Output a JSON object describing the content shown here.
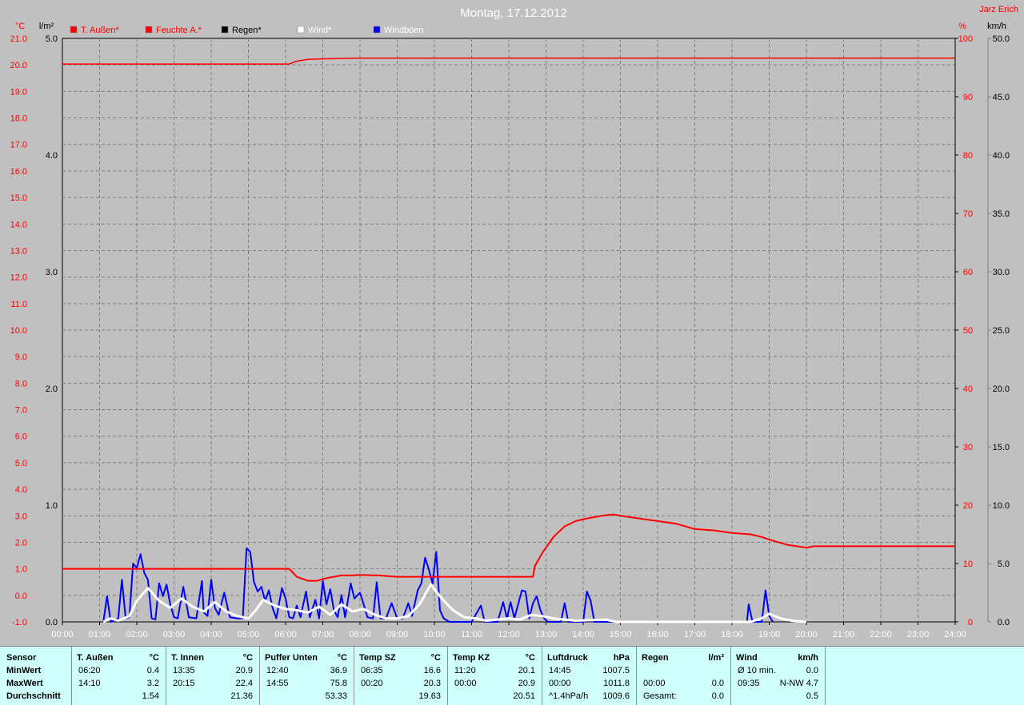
{
  "header": {
    "title": "Montag, 17.12.2012",
    "station": "Jarz Erich"
  },
  "units": {
    "temp": "°C",
    "rain": "l/m²",
    "humidity": "%",
    "wind": "km/h"
  },
  "legend": [
    {
      "label": "T. Außen*",
      "color": "#ff0000",
      "text_color": "#ff0000"
    },
    {
      "label": "Feuchte A.*",
      "color": "#ff0000",
      "text_color": "#ff0000"
    },
    {
      "label": "Regen*",
      "color": "#000000",
      "text_color": "#000000"
    },
    {
      "label": "Wind*",
      "color": "#ffffff",
      "text_color": "#ffffff"
    },
    {
      "label": "Windböen",
      "color": "#0000ff",
      "text_color": "#ffffff"
    }
  ],
  "colors": {
    "background": "#c0c0c0",
    "temp": "#ff0000",
    "humidity": "#ff0000",
    "wind": "#ffffff",
    "gust": "#0000ff",
    "grid": "#808080",
    "stats_bg": "#cffffb"
  },
  "axes": {
    "temp_ticks": [
      "21.0",
      "20.0",
      "19.0",
      "18.0",
      "17.0",
      "16.0",
      "15.0",
      "14.0",
      "13.0",
      "12.0",
      "11.0",
      "10.0",
      "9.0",
      "8.0",
      "7.0",
      "6.0",
      "5.0",
      "4.0",
      "3.0",
      "2.0",
      "1.0",
      "0.0",
      "-1.0"
    ],
    "rain_ticks": [
      "5.0",
      "4.0",
      "3.0",
      "2.0",
      "1.0",
      "0.0"
    ],
    "humidity_ticks": [
      "100",
      "90",
      "80",
      "70",
      "60",
      "50",
      "40",
      "30",
      "20",
      "10",
      "0"
    ],
    "wind_ticks": [
      "50.0",
      "45.0",
      "40.0",
      "35.0",
      "30.0",
      "25.0",
      "20.0",
      "15.0",
      "10.0",
      "5.0",
      "0.0"
    ],
    "time_ticks": [
      "00:00",
      "01:00",
      "02:00",
      "03:00",
      "04:00",
      "05:00",
      "06:00",
      "07:00",
      "08:00",
      "09:00",
      "10:00",
      "11:00",
      "12:00",
      "13:00",
      "14:00",
      "15:00",
      "16:00",
      "17:00",
      "18:00",
      "19:00",
      "20:00",
      "21:00",
      "22:00",
      "23:00",
      "24:00"
    ]
  },
  "chart_data": {
    "type": "line",
    "title": "Montag, 17.12.2012",
    "x_unit": "hours",
    "xlim": [
      0,
      24
    ],
    "ylim_temp": [
      -1,
      21
    ],
    "ylim_rain": [
      0,
      5
    ],
    "ylim_humidity": [
      0,
      100
    ],
    "ylim_wind": [
      0,
      50
    ],
    "grid": true,
    "legend_position": "top-left",
    "series": [
      {
        "name": "T. Außen*",
        "axis": "temp",
        "points": [
          [
            0,
            1.0
          ],
          [
            6.1,
            1.0
          ],
          [
            6.3,
            0.7
          ],
          [
            6.6,
            0.55
          ],
          [
            6.85,
            0.55
          ],
          [
            7.1,
            0.65
          ],
          [
            7.5,
            0.75
          ],
          [
            7.8,
            0.75
          ],
          [
            8.0,
            0.77
          ],
          [
            8.5,
            0.75
          ],
          [
            9.0,
            0.7
          ],
          [
            9.5,
            0.7
          ],
          [
            10.0,
            0.7
          ],
          [
            11.0,
            0.7
          ],
          [
            12.0,
            0.7
          ],
          [
            12.65,
            0.7
          ],
          [
            12.7,
            1.1
          ],
          [
            12.9,
            1.6
          ],
          [
            13.2,
            2.2
          ],
          [
            13.5,
            2.6
          ],
          [
            13.8,
            2.8
          ],
          [
            14.1,
            2.9
          ],
          [
            14.5,
            3.0
          ],
          [
            14.8,
            3.05
          ],
          [
            15.0,
            3.0
          ],
          [
            15.5,
            2.9
          ],
          [
            16.0,
            2.8
          ],
          [
            16.5,
            2.7
          ],
          [
            17.0,
            2.5
          ],
          [
            17.5,
            2.45
          ],
          [
            18.0,
            2.35
          ],
          [
            18.5,
            2.3
          ],
          [
            18.8,
            2.2
          ],
          [
            19.0,
            2.1
          ],
          [
            19.5,
            1.9
          ],
          [
            20.0,
            1.8
          ],
          [
            20.2,
            1.85
          ],
          [
            21.0,
            1.85
          ],
          [
            22.0,
            1.85
          ],
          [
            23.0,
            1.85
          ],
          [
            24.0,
            1.85
          ]
        ]
      },
      {
        "name": "Feuchte A.*",
        "axis": "humidity",
        "points": [
          [
            0,
            95.6
          ],
          [
            6.1,
            95.6
          ],
          [
            6.3,
            96.1
          ],
          [
            6.6,
            96.4
          ],
          [
            7.0,
            96.5
          ],
          [
            8.0,
            96.6
          ],
          [
            12.0,
            96.6
          ],
          [
            16.0,
            96.6
          ],
          [
            20.0,
            96.6
          ],
          [
            24.0,
            96.6
          ]
        ]
      },
      {
        "name": "Wind*",
        "axis": "wind",
        "points": [
          [
            1.1,
            0
          ],
          [
            1.3,
            0.3
          ],
          [
            1.5,
            0.1
          ],
          [
            1.8,
            0.5
          ],
          [
            2.0,
            1.8
          ],
          [
            2.3,
            2.9
          ],
          [
            2.6,
            1.8
          ],
          [
            2.9,
            1.2
          ],
          [
            3.2,
            2.0
          ],
          [
            3.5,
            1.3
          ],
          [
            3.8,
            0.9
          ],
          [
            4.1,
            1.7
          ],
          [
            4.4,
            0.9
          ],
          [
            4.7,
            0.5
          ],
          [
            5.0,
            0.3
          ],
          [
            5.2,
            1.0
          ],
          [
            5.4,
            1.9
          ],
          [
            5.7,
            1.4
          ],
          [
            6.0,
            1.1
          ],
          [
            6.3,
            1.0
          ],
          [
            6.6,
            0.8
          ],
          [
            6.9,
            1.3
          ],
          [
            7.2,
            0.6
          ],
          [
            7.5,
            1.5
          ],
          [
            7.8,
            0.9
          ],
          [
            8.1,
            1.1
          ],
          [
            8.4,
            0.6
          ],
          [
            8.7,
            0.3
          ],
          [
            9.0,
            0.3
          ],
          [
            9.3,
            0.5
          ],
          [
            9.6,
            1.5
          ],
          [
            9.9,
            3.2
          ],
          [
            10.2,
            2.0
          ],
          [
            10.5,
            1.0
          ],
          [
            10.8,
            0.4
          ],
          [
            11.1,
            0.3
          ],
          [
            11.4,
            0.1
          ],
          [
            11.7,
            0.2
          ],
          [
            12.0,
            0.3
          ],
          [
            12.3,
            0.2
          ],
          [
            12.6,
            0.6
          ],
          [
            12.9,
            0.5
          ],
          [
            13.2,
            0.3
          ],
          [
            13.5,
            0.2
          ],
          [
            13.8,
            0.1
          ],
          [
            14.2,
            0.15
          ],
          [
            14.6,
            0.2
          ],
          [
            14.9,
            0
          ],
          [
            16.0,
            0
          ],
          [
            18.5,
            0
          ],
          [
            18.8,
            0.3
          ],
          [
            19.0,
            0.7
          ],
          [
            19.3,
            0.3
          ],
          [
            19.6,
            0.1
          ],
          [
            20.0,
            0
          ]
        ]
      },
      {
        "name": "Windböen",
        "axis": "wind",
        "points": [
          [
            1.1,
            0
          ],
          [
            1.2,
            2.2
          ],
          [
            1.3,
            0
          ],
          [
            1.5,
            0.3
          ],
          [
            1.6,
            3.6
          ],
          [
            1.7,
            0.3
          ],
          [
            1.8,
            0.4
          ],
          [
            1.9,
            5.0
          ],
          [
            2.0,
            4.6
          ],
          [
            2.1,
            5.8
          ],
          [
            2.2,
            4.2
          ],
          [
            2.3,
            3.6
          ],
          [
            2.4,
            0.3
          ],
          [
            2.5,
            0.2
          ],
          [
            2.6,
            3.3
          ],
          [
            2.7,
            2.2
          ],
          [
            2.8,
            3.2
          ],
          [
            2.9,
            1.5
          ],
          [
            3.0,
            0.4
          ],
          [
            3.1,
            0.3
          ],
          [
            3.25,
            3.0
          ],
          [
            3.4,
            0.4
          ],
          [
            3.6,
            0.3
          ],
          [
            3.75,
            3.5
          ],
          [
            3.8,
            0.8
          ],
          [
            3.9,
            0.5
          ],
          [
            4.0,
            3.6
          ],
          [
            4.1,
            1.2
          ],
          [
            4.2,
            0.6
          ],
          [
            4.35,
            2.5
          ],
          [
            4.5,
            0.4
          ],
          [
            4.7,
            0.3
          ],
          [
            4.85,
            0.3
          ],
          [
            4.95,
            6.3
          ],
          [
            5.05,
            6.0
          ],
          [
            5.15,
            3.4
          ],
          [
            5.25,
            2.6
          ],
          [
            5.35,
            3.0
          ],
          [
            5.45,
            1.8
          ],
          [
            5.55,
            2.7
          ],
          [
            5.65,
            1.2
          ],
          [
            5.75,
            0.3
          ],
          [
            5.9,
            2.9
          ],
          [
            6.0,
            2.0
          ],
          [
            6.1,
            0.4
          ],
          [
            6.2,
            0.3
          ],
          [
            6.3,
            1.4
          ],
          [
            6.4,
            0.4
          ],
          [
            6.55,
            2.6
          ],
          [
            6.65,
            0.4
          ],
          [
            6.8,
            1.9
          ],
          [
            6.9,
            0.3
          ],
          [
            7.0,
            3.5
          ],
          [
            7.1,
            1.5
          ],
          [
            7.2,
            2.8
          ],
          [
            7.3,
            1.0
          ],
          [
            7.4,
            0.4
          ],
          [
            7.5,
            2.3
          ],
          [
            7.6,
            0.4
          ],
          [
            7.75,
            3.3
          ],
          [
            7.85,
            2.0
          ],
          [
            8.0,
            2.5
          ],
          [
            8.1,
            1.5
          ],
          [
            8.2,
            0.4
          ],
          [
            8.35,
            0.3
          ],
          [
            8.45,
            3.4
          ],
          [
            8.55,
            0.3
          ],
          [
            8.7,
            0.3
          ],
          [
            8.85,
            1.6
          ],
          [
            9.0,
            0.3
          ],
          [
            9.15,
            0.3
          ],
          [
            9.3,
            1.6
          ],
          [
            9.4,
            0.5
          ],
          [
            9.55,
            2.7
          ],
          [
            9.65,
            3.3
          ],
          [
            9.75,
            5.5
          ],
          [
            9.85,
            4.5
          ],
          [
            9.95,
            3.3
          ],
          [
            10.05,
            6.0
          ],
          [
            10.15,
            1.0
          ],
          [
            10.25,
            0.3
          ],
          [
            10.4,
            0
          ],
          [
            11.0,
            0
          ],
          [
            11.25,
            1.4
          ],
          [
            11.35,
            0
          ],
          [
            11.7,
            0
          ],
          [
            11.85,
            1.7
          ],
          [
            11.95,
            0.3
          ],
          [
            12.05,
            1.7
          ],
          [
            12.15,
            0.3
          ],
          [
            12.35,
            2.7
          ],
          [
            12.45,
            2.6
          ],
          [
            12.55,
            0.3
          ],
          [
            12.65,
            1.6
          ],
          [
            12.75,
            2.2
          ],
          [
            12.85,
            1.0
          ],
          [
            12.95,
            0.3
          ],
          [
            13.05,
            0
          ],
          [
            13.4,
            0
          ],
          [
            13.5,
            1.6
          ],
          [
            13.6,
            0
          ],
          [
            14.0,
            0
          ],
          [
            14.1,
            2.6
          ],
          [
            14.2,
            1.8
          ],
          [
            14.3,
            0
          ],
          [
            18.4,
            0
          ],
          [
            18.45,
            1.5
          ],
          [
            18.55,
            0
          ],
          [
            18.8,
            0
          ],
          [
            18.9,
            2.7
          ],
          [
            19.0,
            0.5
          ],
          [
            19.1,
            0
          ]
        ]
      }
    ]
  },
  "stats": {
    "sensor": {
      "header": "Sensor",
      "min_label": "MinWert",
      "max_label": "MaxWert",
      "avg_label": "Durchschnitt"
    },
    "columns": [
      {
        "name": "T. Außen",
        "unit": "°C",
        "min_time": "06:20",
        "min_val": "0.4",
        "max_time": "14:10",
        "max_val": "3.2",
        "avg_label": "",
        "avg_val": "1.54"
      },
      {
        "name": "T. Innen",
        "unit": "°C",
        "min_time": "13:35",
        "min_val": "20.9",
        "max_time": "20:15",
        "max_val": "22.4",
        "avg_label": "",
        "avg_val": "21.36"
      },
      {
        "name": "Puffer Unten",
        "unit": "°C",
        "min_time": "12:40",
        "min_val": "36.9",
        "max_time": "14:55",
        "max_val": "75.8",
        "avg_label": "",
        "avg_val": "53.33"
      },
      {
        "name": "Temp SZ",
        "unit": "°C",
        "min_time": "06:35",
        "min_val": "16.6",
        "max_time": "00:20",
        "max_val": "20.3",
        "avg_label": "",
        "avg_val": "19.63"
      },
      {
        "name": "Temp KZ",
        "unit": "°C",
        "min_time": "11:20",
        "min_val": "20.1",
        "max_time": "00:00",
        "max_val": "20.9",
        "avg_label": "",
        "avg_val": "20.51"
      },
      {
        "name": "Luftdruck",
        "unit": "hPa",
        "min_time": "14:45",
        "min_val": "1007.5",
        "max_time": "00:00",
        "max_val": "1011.8",
        "avg_label": "^1.4hPa/h",
        "avg_val": "1009.6"
      },
      {
        "name": "Regen",
        "unit": "l/m²",
        "min_time": "",
        "min_val": "",
        "max_time": "00:00",
        "max_val": "0.0",
        "avg_label": "Gesamt:",
        "avg_val": "0.0"
      },
      {
        "name": "Wind",
        "unit": "km/h",
        "min_time": "Ø 10 min.",
        "min_val": "0.0",
        "max_time": "09:35",
        "max_val": "N-NW 4.7",
        "avg_label": "",
        "avg_val": "0.5"
      }
    ]
  }
}
